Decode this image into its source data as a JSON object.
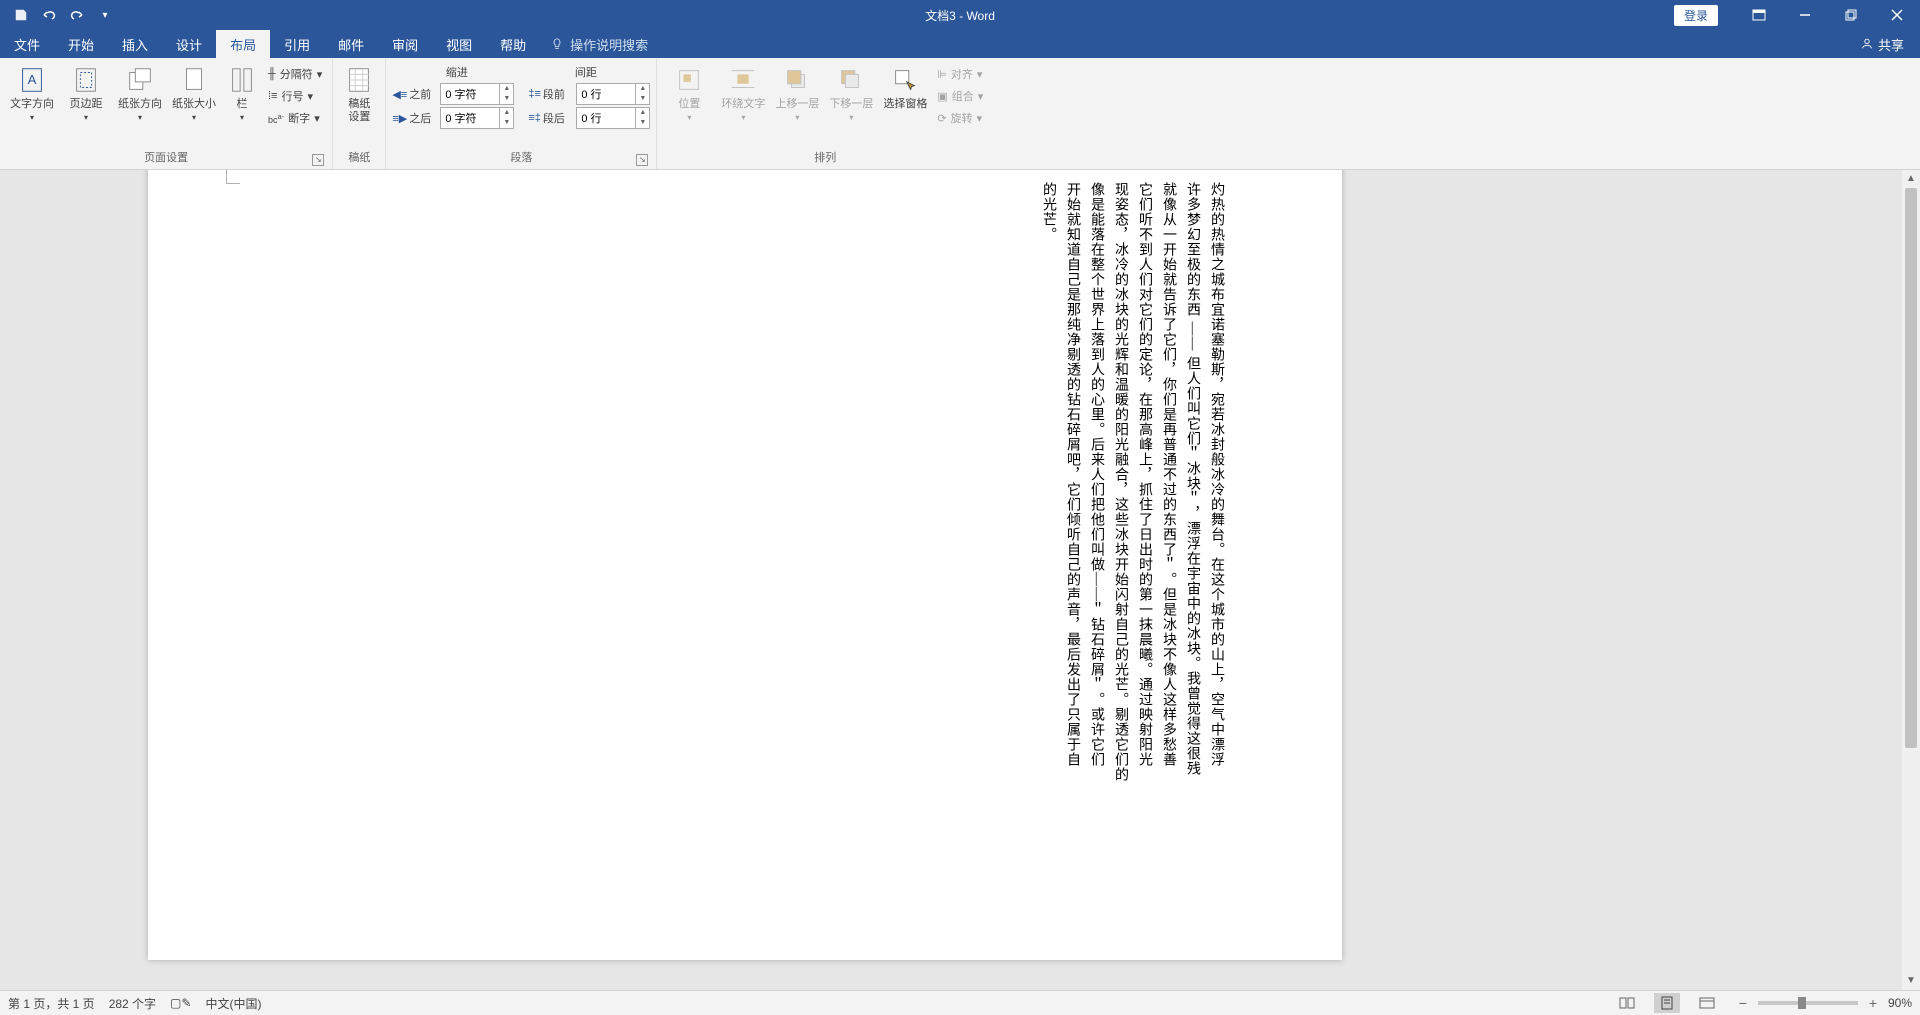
{
  "app": {
    "title": "文档3 - Word"
  },
  "qat": {
    "save": "保存",
    "undo": "撤销",
    "redo": "重做",
    "customize": "自定义"
  },
  "login": "登录",
  "tabs": {
    "file": "文件",
    "home": "开始",
    "insert": "插入",
    "design": "设计",
    "layout": "布局",
    "references": "引用",
    "mailings": "邮件",
    "review": "审阅",
    "view": "视图",
    "help": "帮助",
    "tellme": "操作说明搜索",
    "share": "共享"
  },
  "ribbon": {
    "pageSetup": {
      "label": "页面设置",
      "textDirection": "文字方向",
      "margins": "页边距",
      "orientation": "纸张方向",
      "size": "纸张大小",
      "columns": "栏",
      "breaks": "分隔符",
      "lineNumbers": "行号",
      "hyphenation": "断字"
    },
    "draft": {
      "label": "稿纸",
      "settings": "稿纸\n设置"
    },
    "paragraph": {
      "label": "段落",
      "indent": "缩进",
      "spacing": "间距",
      "before": "之前",
      "after": "之后",
      "spaceBefore": "段前",
      "spaceAfter": "段后",
      "indentBeforeVal": "0 字符",
      "indentAfterVal": "0 字符",
      "spaceBeforeVal": "0 行",
      "spaceAfterVal": "0 行"
    },
    "arrange": {
      "label": "排列",
      "position": "位置",
      "wrap": "环绕文字",
      "bringForward": "上移一层",
      "sendBackward": "下移一层",
      "selectionPane": "选择窗格",
      "align": "对齐",
      "group": "组合",
      "rotate": "旋转"
    }
  },
  "document": {
    "lines": [
      "灼热的热情之城布宜诺塞勒斯，宛若冰封般冰冷的舞台。在这个城市的山上，空气中漂浮",
      "许多梦幻至极的东西 —— 但人们叫它们＂冰块＂，漂浮在宇宙中的冰块。我曾觉得这很残",
      "就像从一开始就告诉了它们，你们是再普通不过的东西了＂。但是冰块不像人这样多愁善",
      "它们听不到人们对它们的定论，在那高峰上，抓住了日出时的第一抹晨曦。通过映射阳光",
      "现姿态，冰冷的冰块的光辉和温暖的阳光融合，这些冰块开始闪射自己的光芒。剔透它们的",
      "像是能落在整个世界上落到人的心里。后来人们把他们叫做——＂钻石碎屑＂。或许它们",
      "开始就知道自己是那纯净剔透的钻石碎屑吧，它们倾听自己的声音，最后发出了只属于自",
      "的光芒。"
    ]
  },
  "status": {
    "page": "第 1 页，共 1 页",
    "words": "282 个字",
    "lang": "中文(中国)",
    "zoom": "90%"
  }
}
